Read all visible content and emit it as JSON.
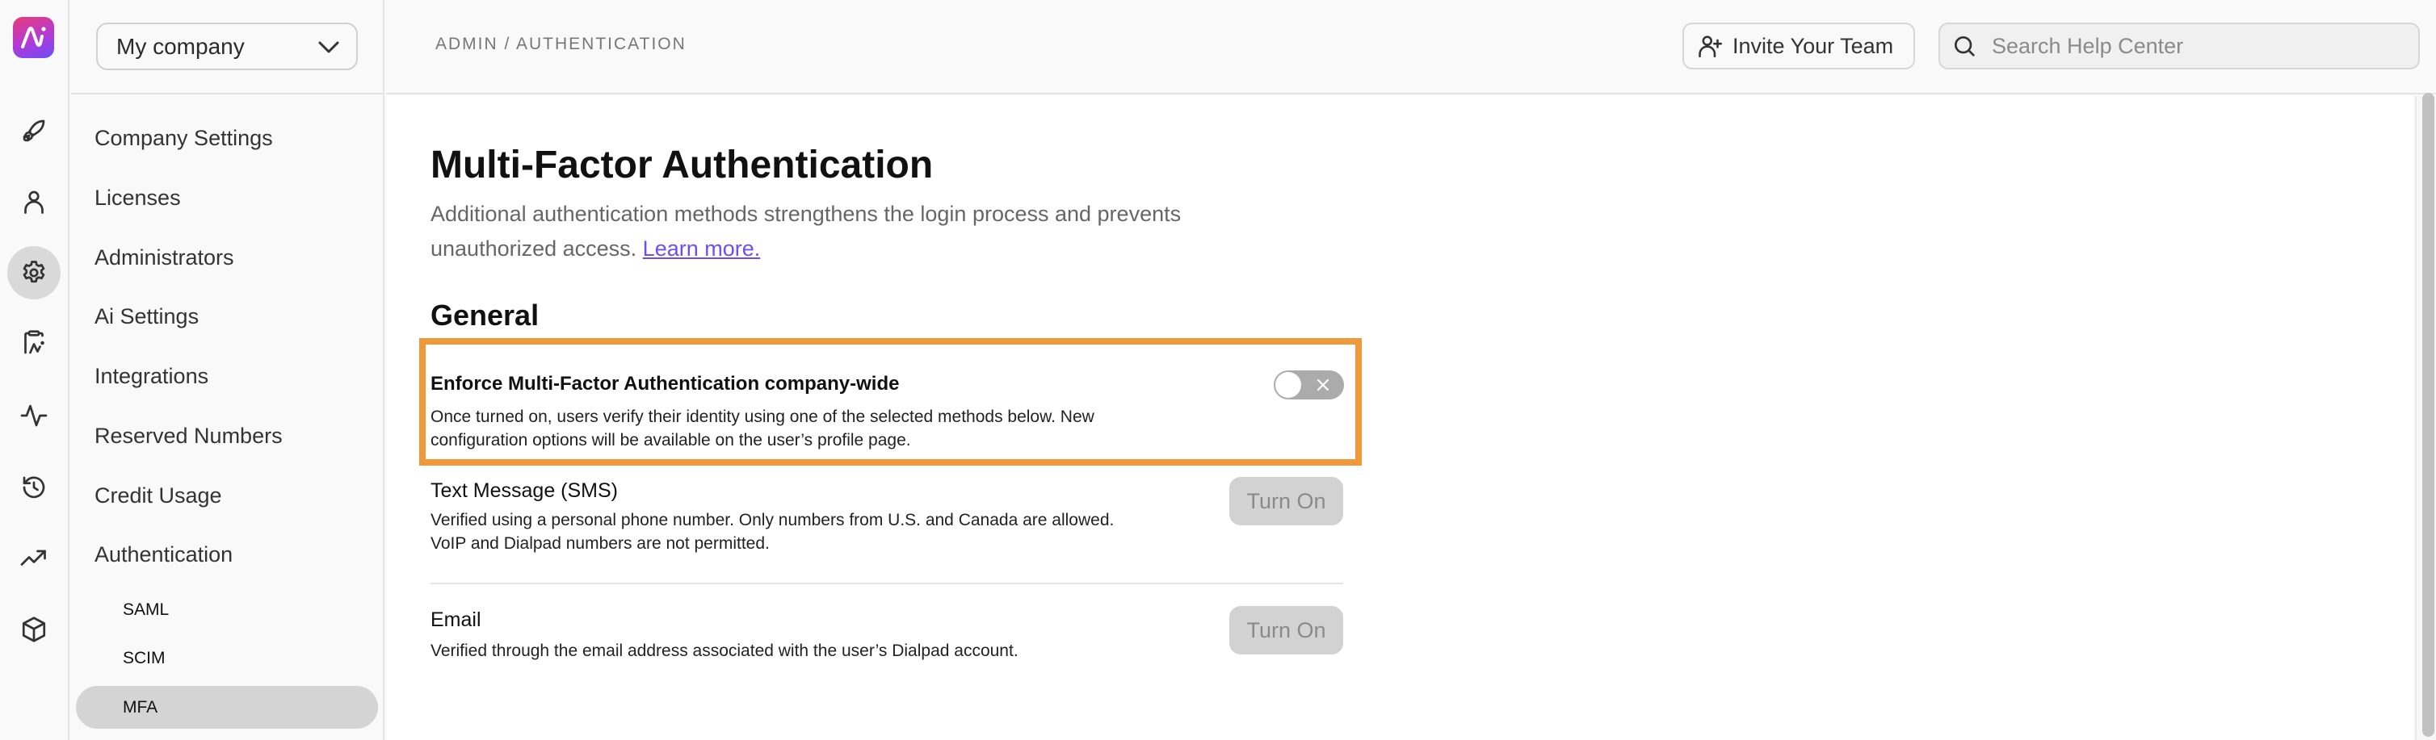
{
  "rail": {
    "logo": "dialpad-ai-logo",
    "icons": [
      {
        "name": "rocket-icon",
        "label": "Get started"
      },
      {
        "name": "person-icon",
        "label": "Users"
      },
      {
        "name": "gear-icon",
        "label": "Admin settings",
        "active": true
      },
      {
        "name": "clipboard-ai-icon",
        "label": "Ai playbooks"
      },
      {
        "name": "activity-icon",
        "label": "Activity"
      },
      {
        "name": "history-icon",
        "label": "History"
      },
      {
        "name": "trending-up-icon",
        "label": "Analytics"
      },
      {
        "name": "box-icon",
        "label": "Apps"
      }
    ]
  },
  "sidebar": {
    "company_select": "My company",
    "items": [
      {
        "label": "Company Settings"
      },
      {
        "label": "Licenses"
      },
      {
        "label": "Administrators"
      },
      {
        "label": "Ai Settings"
      },
      {
        "label": "Integrations"
      },
      {
        "label": "Reserved Numbers"
      },
      {
        "label": "Credit Usage"
      },
      {
        "label": "Authentication"
      }
    ],
    "sub_items": [
      {
        "label": "SAML"
      },
      {
        "label": "SCIM"
      },
      {
        "label": "MFA",
        "active": true
      }
    ]
  },
  "header": {
    "breadcrumb": "ADMIN / AUTHENTICATION",
    "invite_label": "Invite Your Team",
    "search_placeholder": "Search Help Center",
    "search_value": ""
  },
  "main": {
    "title": "Multi-Factor Authentication",
    "description": "Additional authentication methods strengthens the login process and prevents unauthorized access.",
    "learn_more": "Learn more.",
    "section": "General",
    "enforce": {
      "title": "Enforce Multi-Factor Authentication company-wide",
      "description": "Once turned on, users verify their identity using one of the selected methods below. New configuration options will be available on the user’s profile page.",
      "enabled": false
    },
    "methods": [
      {
        "title": "Text Message (SMS)",
        "description": "Verified using a personal phone number. Only numbers from U.S. and Canada are allowed. VoIP and Dialpad numbers are not permitted.",
        "button": "Turn On"
      },
      {
        "title": "Email",
        "description": "Verified through the email address associated with the user’s Dialpad account.",
        "button": "Turn On"
      }
    ]
  },
  "colors": {
    "highlight": "#f0993a",
    "link": "#6d4ff0",
    "toggle_off": "#ababab",
    "active_bg": "#d4d4d4"
  }
}
